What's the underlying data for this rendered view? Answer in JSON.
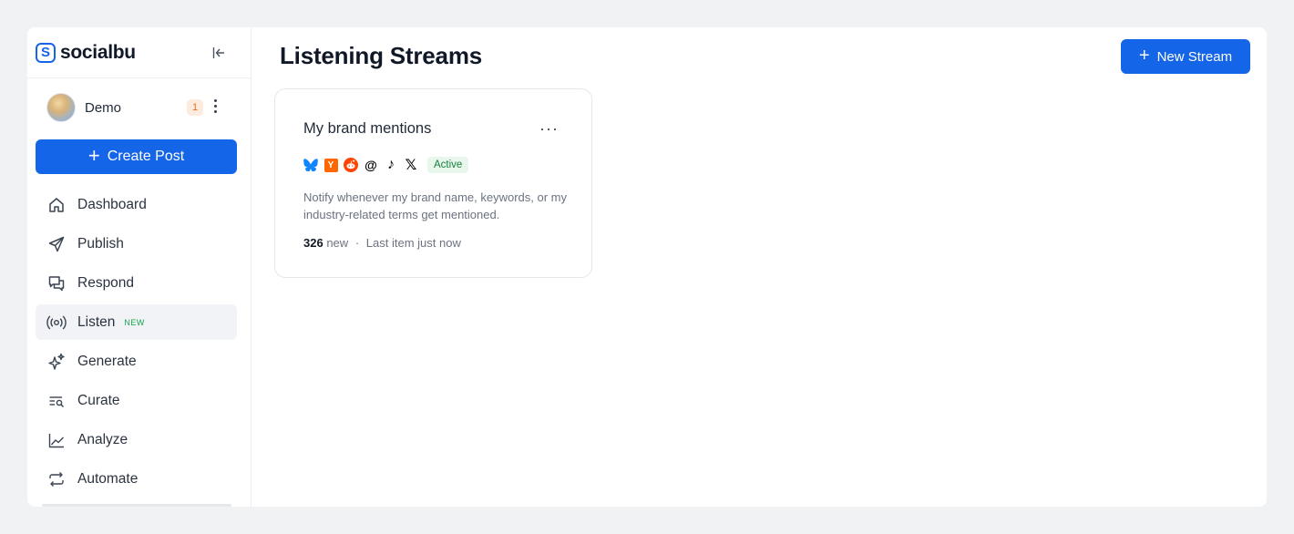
{
  "brand": {
    "name": "socialbu",
    "logo_letter": "S"
  },
  "account": {
    "name": "Demo",
    "notification_count": "1"
  },
  "sidebar": {
    "create_label": "Create Post",
    "items": [
      {
        "label": "Dashboard",
        "icon": "home-icon"
      },
      {
        "label": "Publish",
        "icon": "send-icon"
      },
      {
        "label": "Respond",
        "icon": "chat-icon"
      },
      {
        "label": "Listen",
        "icon": "broadcast-icon",
        "tag": "NEW",
        "active": true
      },
      {
        "label": "Generate",
        "icon": "sparkle-icon"
      },
      {
        "label": "Curate",
        "icon": "list-search-icon"
      },
      {
        "label": "Analyze",
        "icon": "chart-line-icon"
      },
      {
        "label": "Automate",
        "icon": "repeat-icon"
      }
    ]
  },
  "main": {
    "title": "Listening Streams",
    "new_stream_label": "New Stream",
    "streams": [
      {
        "title": "My brand mentions",
        "networks": [
          "bluesky",
          "hacker-news",
          "reddit",
          "threads",
          "tiktok",
          "x"
        ],
        "hn_letter": "Y",
        "threads_glyph": "@",
        "tiktok_glyph": "♪",
        "x_glyph": "𝕏",
        "status": "Active",
        "description": "Notify whenever my brand name, keywords, or my industry-related terms get mentioned.",
        "new_count": "326",
        "new_label": "new",
        "separator": "·",
        "last_item": "Last item just now"
      }
    ]
  },
  "colors": {
    "accent": "#1565e8",
    "active_green": "#17803d",
    "badge_orange": "#ef6c1a"
  }
}
